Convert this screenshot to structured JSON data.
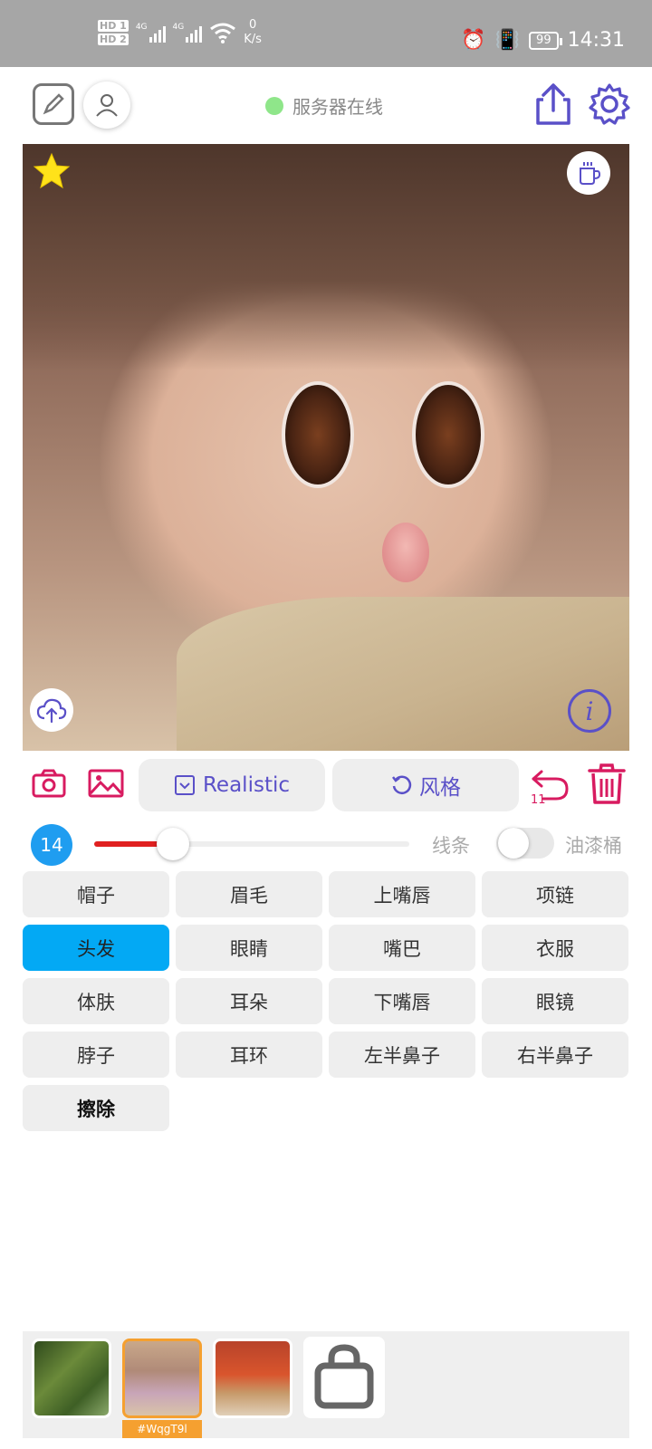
{
  "status_bar": {
    "hd1": "HD 1",
    "hd2": "HD 2",
    "sig1_label": "4G",
    "sig2_label": "4G",
    "net_speed_value": "0",
    "net_speed_unit": "K/s",
    "battery": "99",
    "time": "14:31"
  },
  "toolbar": {
    "server_status": "服务器在线",
    "server_dot_color": "#8fe68a"
  },
  "canvas": {
    "icons": [
      "star-icon",
      "coffee-icon",
      "cloud-upload-icon",
      "info-icon"
    ]
  },
  "actions": {
    "style_mode_label": "Realistic",
    "style_label": "风格",
    "undo_count": "11",
    "accent_color": "#5a50c8",
    "danger_color": "#d81b60"
  },
  "brush": {
    "size": "14",
    "slider_value_fraction": 0.25,
    "line_label": "线条",
    "bucket_label": "油漆桶",
    "bucket_enabled": false
  },
  "parts": [
    {
      "label": "帽子",
      "active": false
    },
    {
      "label": "眉毛",
      "active": false
    },
    {
      "label": "上嘴唇",
      "active": false
    },
    {
      "label": "项链",
      "active": false
    },
    {
      "label": "头发",
      "active": true
    },
    {
      "label": "眼睛",
      "active": false
    },
    {
      "label": "嘴巴",
      "active": false
    },
    {
      "label": "衣服",
      "active": false
    },
    {
      "label": "体肤",
      "active": false
    },
    {
      "label": "耳朵",
      "active": false
    },
    {
      "label": "下嘴唇",
      "active": false
    },
    {
      "label": "眼镜",
      "active": false
    },
    {
      "label": "脖子",
      "active": false
    },
    {
      "label": "耳环",
      "active": false
    },
    {
      "label": "左半鼻子",
      "active": false
    },
    {
      "label": "右半鼻子",
      "active": false
    },
    {
      "label": "擦除",
      "active": false
    }
  ],
  "history": {
    "selected_tag": "#WqgT9l"
  }
}
